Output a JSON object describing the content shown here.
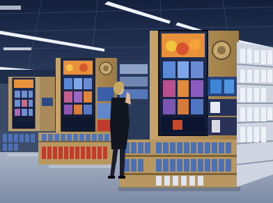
{
  "scene": {
    "description_label": "",
    "colors": {
      "ceiling": "#1b2a4a",
      "ceiling_light": "#e9f0ff",
      "wall_top": "#2d3f63",
      "floor": "#9aa7bd",
      "floor_reflect": "#6f7f9c",
      "shelf_gold": "#b8955a",
      "shelf_dark": "#3a4a60",
      "kiosk_frame": "#c9b99a",
      "screen_bg": "#1d2b4d",
      "bottle_blue": "#3b5fa8",
      "bottle_white": "#e6ecf5",
      "product_red": "#c23a2c",
      "product_orange": "#e8913a"
    },
    "icons": {
      "kiosk_badge": "circle-badge-icon"
    }
  }
}
